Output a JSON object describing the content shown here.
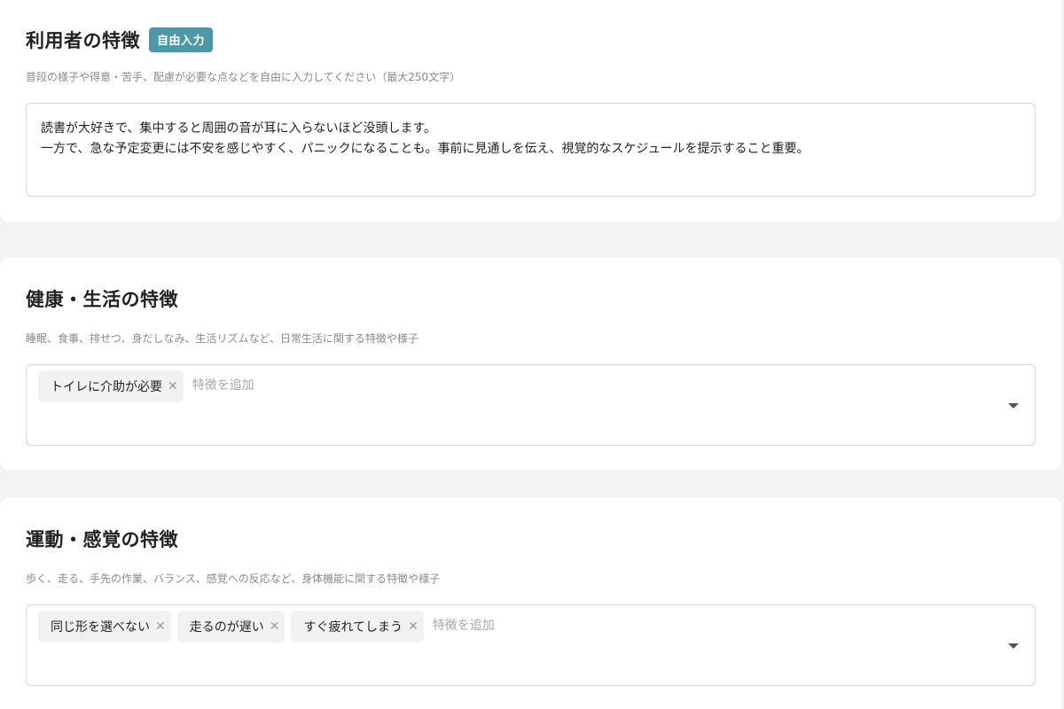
{
  "user_features": {
    "title": "利用者の特徴",
    "badge": "自由入力",
    "description": "普段の様子や得意・苦手、配慮が必要な点などを自由に入力してください（最大250文字）",
    "text_line1": "読書が大好きで、集中すると周囲の音が耳に入らないほど没頭します。",
    "text_line2": "一方で、急な予定変更には不安を感じやすく、パニックになることも。事前に見通しを伝え、視覚的なスケジュールを提示すること重要。"
  },
  "health_features": {
    "title": "健康・生活の特徴",
    "description": "睡眠、食事、排せつ、身だしなみ、生活リズムなど、日常生活に関する特徴や様子",
    "tags": [
      "トイレに介助が必要"
    ],
    "placeholder": "特徴を追加"
  },
  "motor_features": {
    "title": "運動・感覚の特徴",
    "description": "歩く、走る、手先の作業、バランス、感覚への反応など、身体機能に関する特徴や様子",
    "tags": [
      "同じ形を選べない",
      "走るのが遅い",
      "すぐ疲れてしまう"
    ],
    "placeholder": "特徴を追加"
  },
  "icons": {
    "tag_remove": "close-icon",
    "dropdown": "chevron-down-icon"
  },
  "colors": {
    "badge": "#4a98a9",
    "background": "#f3f3f3",
    "card": "#ffffff"
  }
}
